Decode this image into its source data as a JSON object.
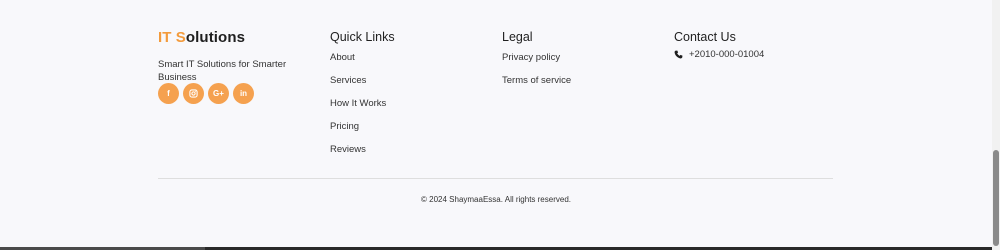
{
  "brand": {
    "title_accent": "IT S",
    "title_rest": "olutions",
    "tagline": "Smart IT Solutions for Smarter Business"
  },
  "socials": [
    {
      "icon": "facebook-icon",
      "glyph": "f"
    },
    {
      "icon": "instagram-icon",
      "glyph": "◎"
    },
    {
      "icon": "google-plus-icon",
      "glyph": "G+"
    },
    {
      "icon": "linkedin-icon",
      "glyph": "in"
    }
  ],
  "quick_links": {
    "title": "Quick Links",
    "items": [
      "About",
      "Services",
      "How It Works",
      "Pricing",
      "Reviews"
    ]
  },
  "legal": {
    "title": "Legal",
    "items": [
      "Privacy policy",
      "Terms of service"
    ]
  },
  "contact": {
    "title": "Contact Us",
    "phone": "+2010-000-01004"
  },
  "copyright": "© 2024 ShaymaaEssa. All rights reserved.",
  "colors": {
    "accent": "#f39b3c",
    "social_bg": "#f5a14f",
    "background": "#f8f8fb"
  }
}
